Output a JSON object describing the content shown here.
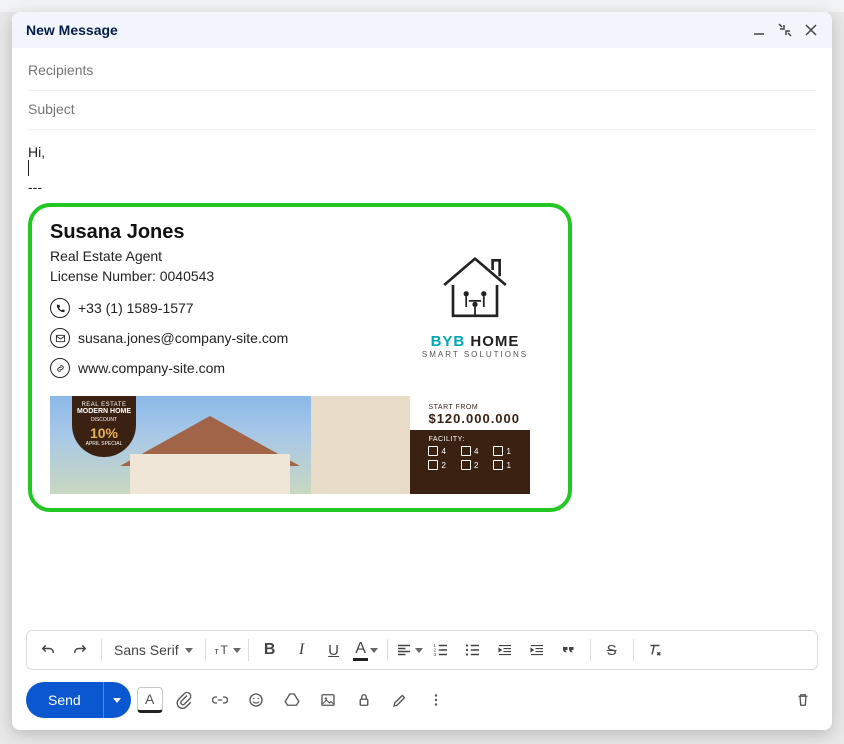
{
  "window": {
    "title": "New Message"
  },
  "fields": {
    "recipients_placeholder": "Recipients",
    "recipients_value": "",
    "subject_placeholder": "Subject",
    "subject_value": ""
  },
  "body": {
    "greeting": "Hi,",
    "separator": "---"
  },
  "signature": {
    "name": "Susana Jones",
    "role": "Real Estate Agent",
    "license": "License Number: 0040543",
    "phone": "+33 (1) 1589-1577",
    "email": "susana.jones@company-site.com",
    "website": "www.company-site.com",
    "logo_brand_1": "BYB",
    "logo_brand_2": " HOME",
    "logo_tagline": "SMART SOLUTIONS",
    "banner": {
      "badge_line1": "REAL ESTATE",
      "badge_line2": "MODERN HOME",
      "badge_line3": "DISCOUNT",
      "badge_pct": "10%",
      "badge_line4": "APRIL SPECIAL",
      "price_label": "START FROM",
      "price_value": "$120.000.000",
      "facility_label": "FACILITY:",
      "facilities": [
        "4",
        "4",
        "1",
        "2",
        "2",
        "1"
      ]
    }
  },
  "toolbar": {
    "font": "Sans Serif"
  },
  "actions": {
    "send": "Send"
  }
}
